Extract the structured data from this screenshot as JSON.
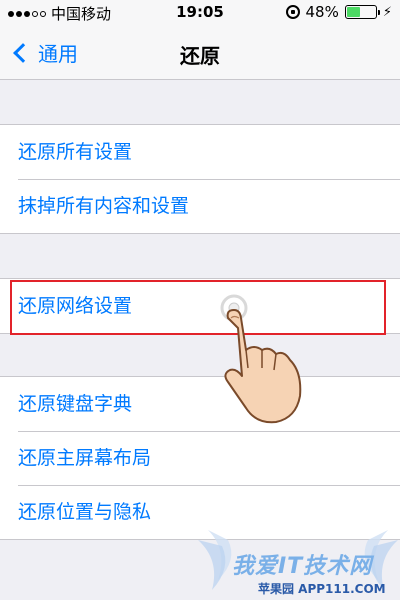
{
  "status": {
    "carrier": "中国移动",
    "time": "19:05",
    "battery_percent": "48%",
    "battery_level": 0.48
  },
  "nav": {
    "back_label": "通用",
    "title": "还原"
  },
  "groups": [
    {
      "items": [
        "还原所有设置",
        "抹掉所有内容和设置"
      ]
    },
    {
      "items": [
        "还原网络设置"
      ]
    },
    {
      "items": [
        "还原键盘字典",
        "还原主屏幕布局",
        "还原位置与隐私"
      ]
    }
  ],
  "watermark": {
    "title": "我爱IT技术网",
    "subtitle": "苹果园 APP111.COM"
  },
  "colors": {
    "accent": "#007aff",
    "highlight": "#e2232a",
    "background": "#efeff4"
  }
}
